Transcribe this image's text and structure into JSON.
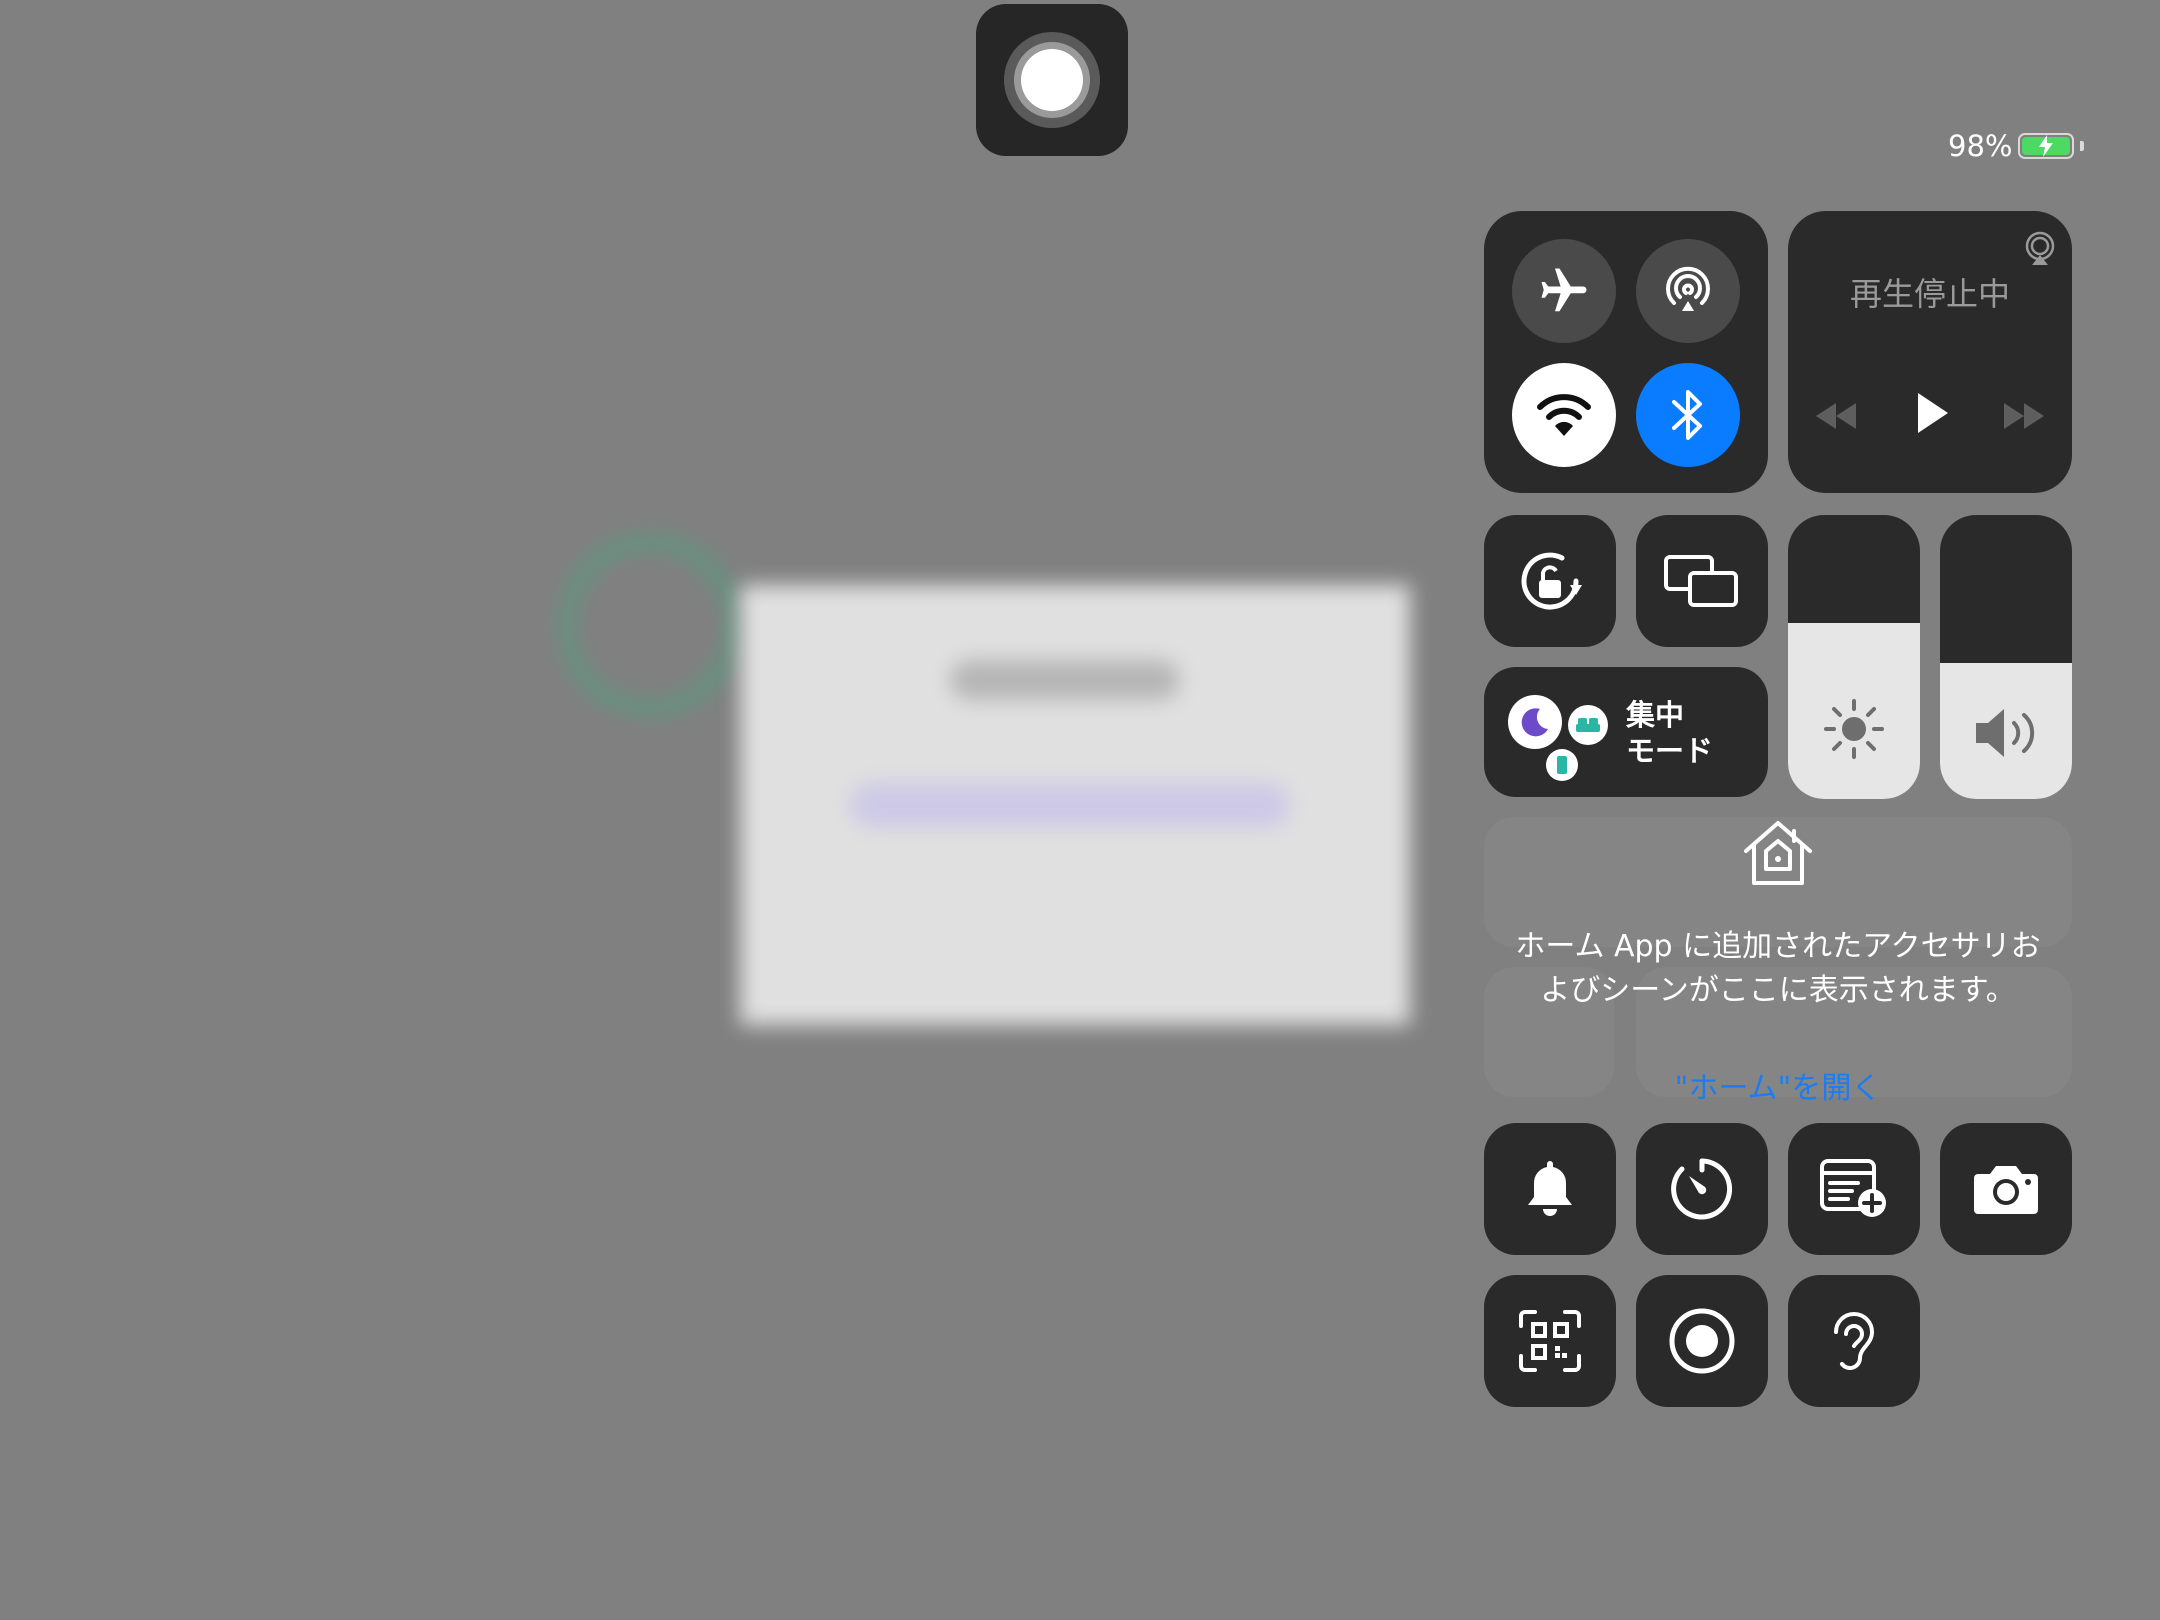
{
  "status": {
    "battery_percent_label": "98%",
    "battery_level": 0.98,
    "charging": true
  },
  "colors": {
    "accent_blue": "#0a7cff",
    "link_blue": "#1d7cf2",
    "battery_green": "#4cd964",
    "tile_bg": "#2a2a2a",
    "slider_fill": "#e6e6e6",
    "backdrop": "#808080"
  },
  "assistive_touch": {
    "icon": "assistive-touch-icon"
  },
  "connectivity": {
    "airplane": {
      "icon": "airplane-icon",
      "on": false
    },
    "airdrop": {
      "icon": "airdrop-icon",
      "on": false
    },
    "wifi": {
      "icon": "wifi-icon",
      "on": true
    },
    "bluetooth": {
      "icon": "bluetooth-icon",
      "on": true
    }
  },
  "now_playing": {
    "title": "再生停止中",
    "airplay_icon": "airplay-icon",
    "controls": [
      "rewind-icon",
      "play-icon",
      "fast-forward-icon"
    ]
  },
  "orientation_lock": {
    "icon": "orientation-lock-icon"
  },
  "screen_mirroring": {
    "icon": "screen-mirroring-icon"
  },
  "focus": {
    "label_line1": "集中",
    "label_line2": "モード",
    "icons": [
      "moon-icon",
      "bed-icon",
      "phone-icon"
    ]
  },
  "brightness": {
    "level": 0.62,
    "icon": "sun-icon"
  },
  "volume": {
    "level": 0.48,
    "icon": "speaker-icon"
  },
  "home": {
    "icon": "home-icon",
    "message": "ホーム App に追加されたアクセサリおよびシーンがここに表示されます。",
    "link": "\"ホーム\"を開く"
  },
  "shortcuts_row1": [
    "bell-icon",
    "timer-icon",
    "quick-note-icon",
    "camera-icon"
  ],
  "shortcuts_row2": [
    "qr-scanner-icon",
    "screen-record-icon",
    "hearing-icon"
  ]
}
